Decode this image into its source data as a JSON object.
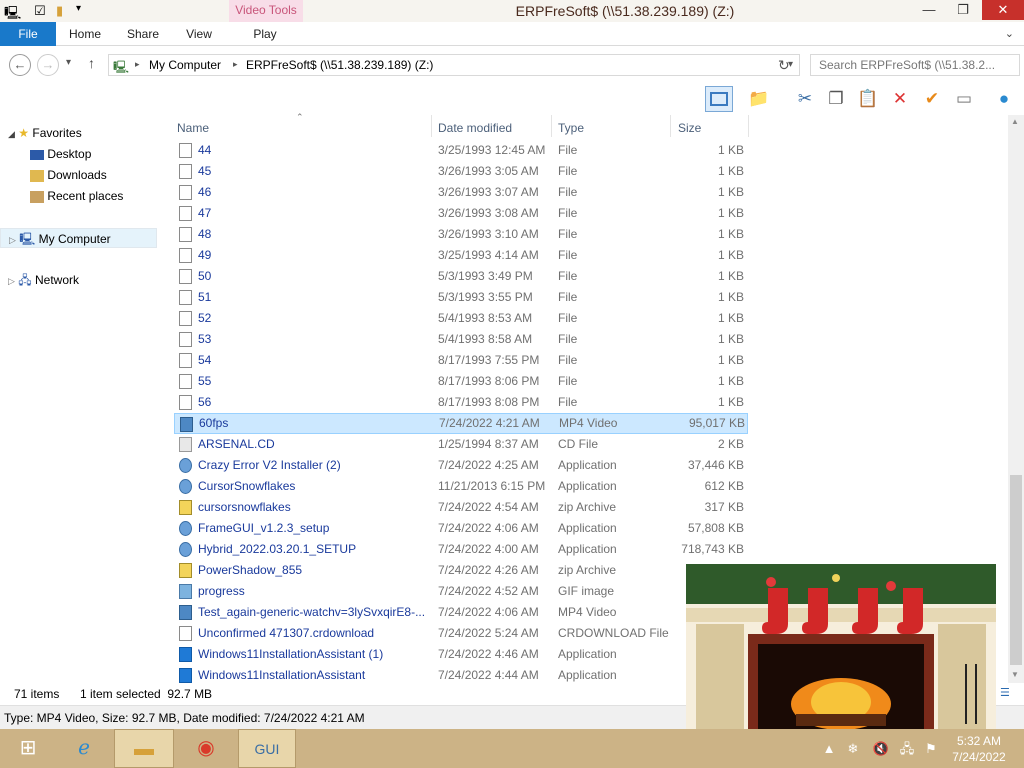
{
  "window": {
    "title": "ERPFreSoft$ (\\\\51.38.239.189) (Z:)",
    "contextual_tab": "Video Tools"
  },
  "ribbon": {
    "tabs": [
      "File",
      "Home",
      "Share",
      "View",
      "Play"
    ]
  },
  "address": {
    "crumbs": [
      "My Computer",
      "ERPFreSoft$ (\\\\51.38.239.189) (Z:)"
    ],
    "search_placeholder": "Search ERPFreSoft$ (\\\\51.38.2..."
  },
  "nav": {
    "favorites_label": "Favorites",
    "favorites": [
      "Desktop",
      "Downloads",
      "Recent places"
    ],
    "computer": "My Computer",
    "network": "Network"
  },
  "columns": {
    "name": "Name",
    "date": "Date modified",
    "type": "Type",
    "size": "Size"
  },
  "files": [
    {
      "name": "44",
      "date": "3/25/1993 12:45 AM",
      "type": "File",
      "size": "1 KB",
      "icon": "file"
    },
    {
      "name": "45",
      "date": "3/26/1993 3:05 AM",
      "type": "File",
      "size": "1 KB",
      "icon": "file"
    },
    {
      "name": "46",
      "date": "3/26/1993 3:07 AM",
      "type": "File",
      "size": "1 KB",
      "icon": "file"
    },
    {
      "name": "47",
      "date": "3/26/1993 3:08 AM",
      "type": "File",
      "size": "1 KB",
      "icon": "file"
    },
    {
      "name": "48",
      "date": "3/26/1993 3:10 AM",
      "type": "File",
      "size": "1 KB",
      "icon": "file"
    },
    {
      "name": "49",
      "date": "3/25/1993 4:14 AM",
      "type": "File",
      "size": "1 KB",
      "icon": "file"
    },
    {
      "name": "50",
      "date": "5/3/1993 3:49 PM",
      "type": "File",
      "size": "1 KB",
      "icon": "file"
    },
    {
      "name": "51",
      "date": "5/3/1993 3:55 PM",
      "type": "File",
      "size": "1 KB",
      "icon": "file"
    },
    {
      "name": "52",
      "date": "5/4/1993 8:53 AM",
      "type": "File",
      "size": "1 KB",
      "icon": "file"
    },
    {
      "name": "53",
      "date": "5/4/1993 8:58 AM",
      "type": "File",
      "size": "1 KB",
      "icon": "file"
    },
    {
      "name": "54",
      "date": "8/17/1993 7:55 PM",
      "type": "File",
      "size": "1 KB",
      "icon": "file"
    },
    {
      "name": "55",
      "date": "8/17/1993 8:06 PM",
      "type": "File",
      "size": "1 KB",
      "icon": "file"
    },
    {
      "name": "56",
      "date": "8/17/1993 8:08 PM",
      "type": "File",
      "size": "1 KB",
      "icon": "file"
    },
    {
      "name": "60fps",
      "date": "7/24/2022 4:21 AM",
      "type": "MP4 Video",
      "size": "95,017 KB",
      "icon": "video",
      "selected": true
    },
    {
      "name": "ARSENAL.CD",
      "date": "1/25/1994 8:37 AM",
      "type": "CD File",
      "size": "2 KB",
      "icon": "cd"
    },
    {
      "name": "Crazy Error V2 Installer (2)",
      "date": "7/24/2022 4:25 AM",
      "type": "Application",
      "size": "37,446 KB",
      "icon": "app"
    },
    {
      "name": "CursorSnowflakes",
      "date": "11/21/2013 6:15 PM",
      "type": "Application",
      "size": "612 KB",
      "icon": "app"
    },
    {
      "name": "cursorsnowflakes",
      "date": "7/24/2022 4:54 AM",
      "type": "zip Archive",
      "size": "317 KB",
      "icon": "zip"
    },
    {
      "name": "FrameGUI_v1.2.3_setup",
      "date": "7/24/2022 4:06 AM",
      "type": "Application",
      "size": "57,808 KB",
      "icon": "app"
    },
    {
      "name": "Hybrid_2022.03.20.1_SETUP",
      "date": "7/24/2022 4:00 AM",
      "type": "Application",
      "size": "718,743 KB",
      "icon": "app"
    },
    {
      "name": "PowerShadow_855",
      "date": "7/24/2022 4:26 AM",
      "type": "zip Archive",
      "size": "",
      "icon": "zip"
    },
    {
      "name": "progress",
      "date": "7/24/2022 4:52 AM",
      "type": "GIF image",
      "size": "",
      "icon": "gif"
    },
    {
      "name": "Test_again-generic-watchv=3lySvxqirE8-...",
      "date": "7/24/2022 4:06 AM",
      "type": "MP4 Video",
      "size": "",
      "icon": "video"
    },
    {
      "name": "Unconfirmed 471307.crdownload",
      "date": "7/24/2022 5:24 AM",
      "type": "CRDOWNLOAD File",
      "size": "",
      "icon": "dl"
    },
    {
      "name": "Windows11InstallationAssistant (1)",
      "date": "7/24/2022 4:46 AM",
      "type": "Application",
      "size": "",
      "icon": "win"
    },
    {
      "name": "Windows11InstallationAssistant",
      "date": "7/24/2022 4:44 AM",
      "type": "Application",
      "size": "",
      "icon": "win"
    }
  ],
  "status": {
    "count": "71 items",
    "selected": "1 item selected  92.7 MB"
  },
  "infobar": "Type: MP4 Video, Size: 92.7 MB, Date modified: 7/24/2022 4:21 AM",
  "clock": {
    "time": "5:32 AM",
    "date": "7/24/2022"
  },
  "colors": {
    "accent": "#1979ca",
    "taskbar": "#ccb386",
    "selection": "#cce8ff",
    "link": "#1a3a9c"
  }
}
